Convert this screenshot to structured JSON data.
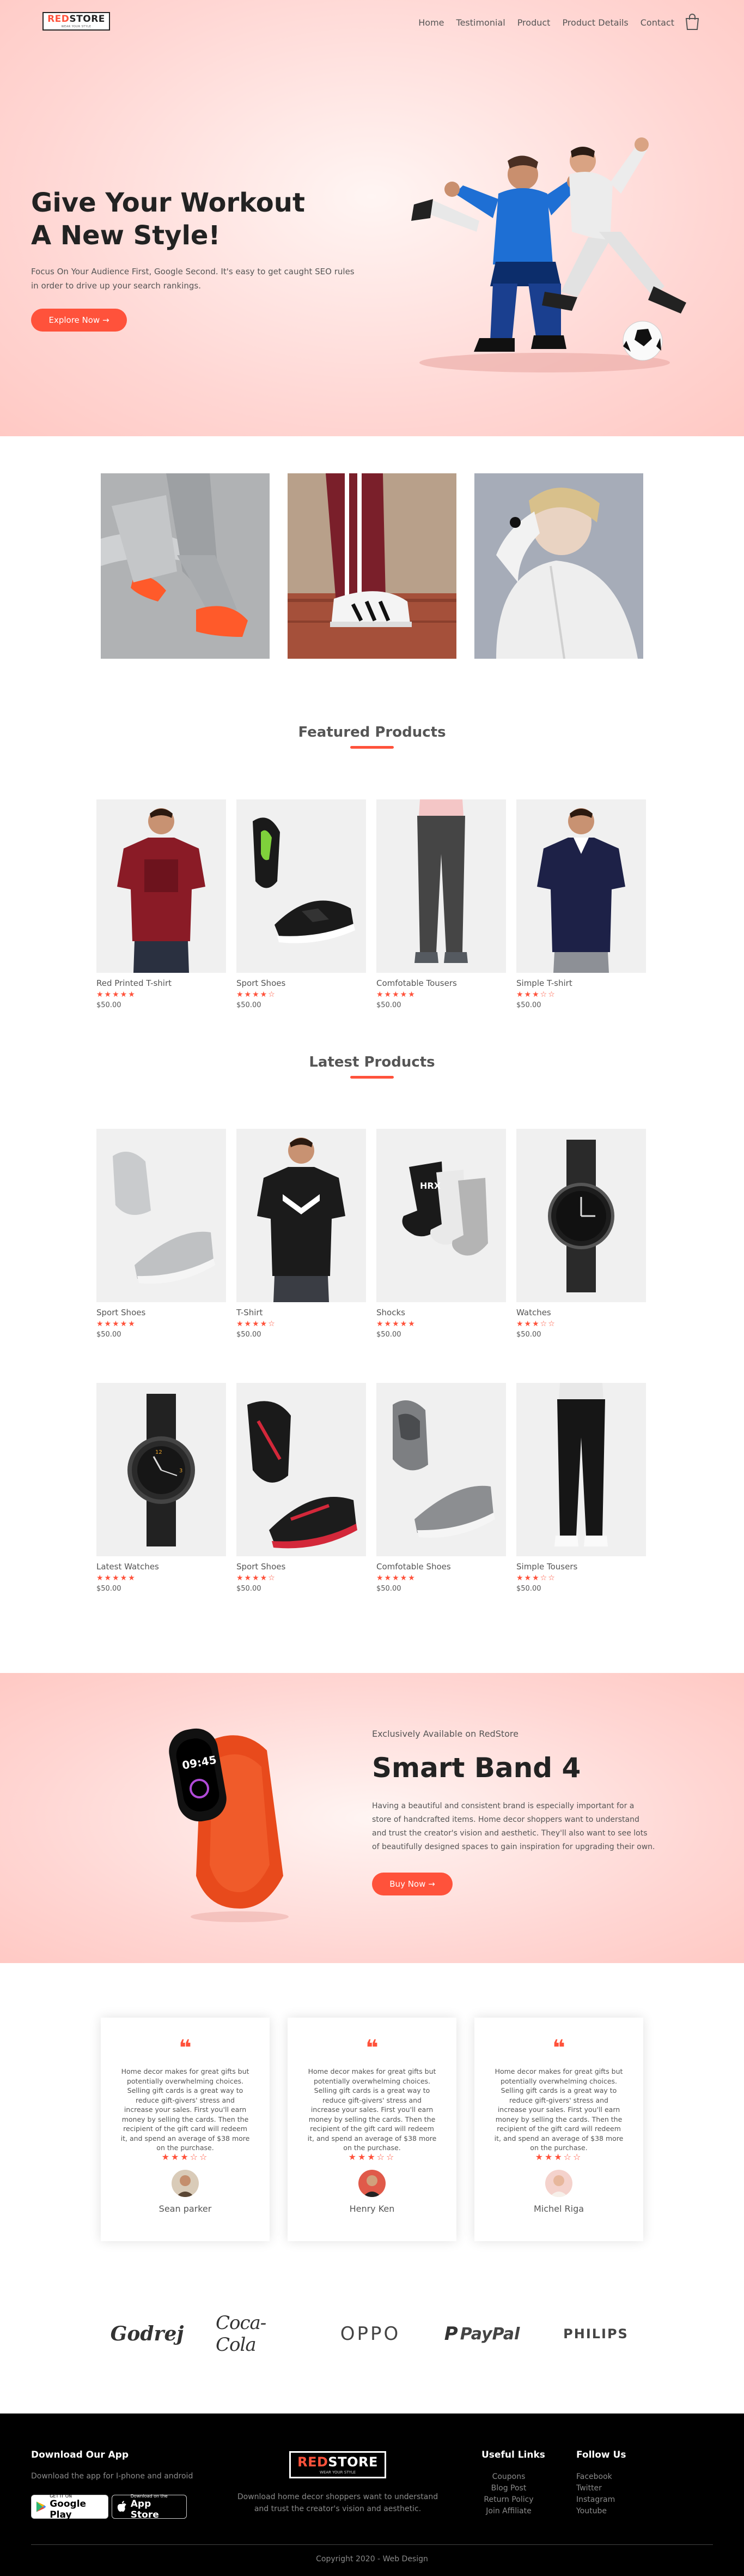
{
  "header": {
    "logo": {
      "red": "RED",
      "dark": "STORE",
      "tagline": "WEAR YOUR STYLE"
    },
    "nav": [
      "Home",
      "Testimonial",
      "Product",
      "Product Details",
      "Contact"
    ],
    "cart_icon": "shopping-bag-icon"
  },
  "hero": {
    "title_line1": "Give Your Workout",
    "title_line2": "A New Style!",
    "text": "Focus On Your Audience First, Google Second. It's easy to get caught SEO rules in order to drive up your search rankings.",
    "button": "Explore Now →"
  },
  "featured": {
    "title": "Featured Products",
    "products": [
      {
        "name": "Red Printed T-shirt",
        "stars": "★★★★★",
        "price": "$50.00"
      },
      {
        "name": "Sport Shoes",
        "stars": "★★★★☆",
        "price": "$50.00"
      },
      {
        "name": "Comfotable Tousers",
        "stars": "★★★★★",
        "price": "$50.00"
      },
      {
        "name": "Simple T-shirt",
        "stars": "★★★☆☆",
        "price": "$50.00"
      }
    ]
  },
  "latest": {
    "title": "Latest Products",
    "products": [
      {
        "name": "Sport Shoes",
        "stars": "★★★★★",
        "price": "$50.00"
      },
      {
        "name": "T-Shirt",
        "stars": "★★★★☆",
        "price": "$50.00"
      },
      {
        "name": "Shocks",
        "stars": "★★★★★",
        "price": "$50.00"
      },
      {
        "name": "Watches",
        "stars": "★★★☆☆",
        "price": "$50.00"
      },
      {
        "name": "Latest Watches",
        "stars": "★★★★★",
        "price": "$50.00"
      },
      {
        "name": "Sport Shoes",
        "stars": "★★★★☆",
        "price": "$50.00"
      },
      {
        "name": "Comfotable Shoes",
        "stars": "★★★★★",
        "price": "$50.00"
      },
      {
        "name": "Simple Tousers",
        "stars": "★★★☆☆",
        "price": "$50.00"
      }
    ]
  },
  "offer": {
    "small": "Exclusively Available on RedStore",
    "title": "Smart Band 4",
    "text": "Having a beautiful and consistent brand is especially important for a store of handcrafted items. Home decor shoppers want to understand and trust the creator's vision and aesthetic. They'll also want to see lots of beautifully designed spaces to gain inspiration for upgrading their own.",
    "button": "Buy Now →",
    "band_time": "09:45"
  },
  "testimonials": [
    {
      "text": "Home decor makes for great gifts but potentially overwhelming choices. Selling gift cards is a great way to reduce gift-givers' stress and increase your sales. First you'll earn money by selling the cards. Then the recipient of the gift card will redeem it, and spend an average of $38 more on the purchase.",
      "stars": "★★★☆☆",
      "name": "Sean parker"
    },
    {
      "text": "Home decor makes for great gifts but potentially overwhelming choices. Selling gift cards is a great way to reduce gift-givers' stress and increase your sales. First you'll earn money by selling the cards. Then the recipient of the gift card will redeem it, and spend an average of $38 more on the purchase.",
      "stars": "★★★☆☆",
      "name": "Henry Ken"
    },
    {
      "text": "Home decor makes for great gifts but potentially overwhelming choices. Selling gift cards is a great way to reduce gift-givers' stress and increase your sales. First you'll earn money by selling the cards. Then the recipient of the gift card will redeem it, and spend an average of $38 more on the purchase.",
      "stars": "★★★☆☆",
      "name": "Michel Riga"
    }
  ],
  "brands": [
    "Godrej",
    "Coca-Cola",
    "OPPO",
    "PayPal",
    "PHILIPS"
  ],
  "footer": {
    "download_title": "Download Our App",
    "download_text": "Download the app for I-phone and android",
    "google_play": {
      "small": "GET IT ON",
      "big": "Google Play"
    },
    "app_store": {
      "small": "Download on the",
      "big": "App Store"
    },
    "logo": {
      "red": "RED",
      "white": "STORE",
      "tagline": "WEAR YOUR STYLE"
    },
    "about_text": "Download home decor shoppers want to understand and trust the creator's vision and aesthetic.",
    "useful_title": "Useful Links",
    "useful_links": [
      "Coupons",
      "Blog Post",
      "Return Policy",
      "Join Affiliate"
    ],
    "follow_title": "Follow Us",
    "follow_links": [
      "Facebook",
      "Twitter",
      "Instagram",
      "Youtube"
    ],
    "copyright": "Copyright 2020 - Web Design"
  },
  "colors": {
    "accent": "#ff523b",
    "hero_bg": "#ffd6d3",
    "footer_bg": "#000000"
  }
}
